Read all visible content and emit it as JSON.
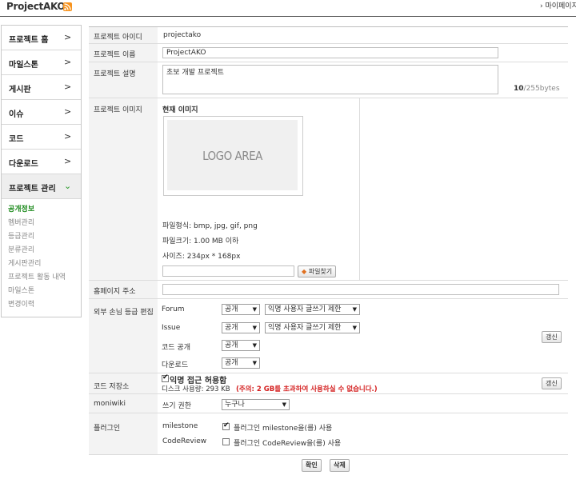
{
  "header": {
    "site_title": "ProjectAKO",
    "rss_icon": "rss-icon",
    "top_link": "› 마이페이지"
  },
  "sidebar": {
    "items": [
      {
        "label": "프로젝트 홈",
        "chevron": ">"
      },
      {
        "label": "마일스톤",
        "chevron": ">"
      },
      {
        "label": "게시판",
        "chevron": ">"
      },
      {
        "label": "이슈",
        "chevron": ">"
      },
      {
        "label": "코드",
        "chevron": ">"
      },
      {
        "label": "다운로드",
        "chevron": ">"
      },
      {
        "label": "프로젝트 관리",
        "chevron": "⌄"
      }
    ],
    "subitems": [
      {
        "label": "공개정보",
        "current": true
      },
      {
        "label": "멤버관리"
      },
      {
        "label": "등급관리"
      },
      {
        "label": "분류관리"
      },
      {
        "label": "게시판관리"
      },
      {
        "label": "프로젝트 활동 내역"
      },
      {
        "label": "마일스톤"
      },
      {
        "label": "변경이력"
      }
    ]
  },
  "form": {
    "project_id": {
      "label": "프로젝트 아이디",
      "value": "projectako"
    },
    "project_name": {
      "label": "프로젝트 이름",
      "value": "ProjectAKO"
    },
    "project_desc": {
      "label": "프로젝트 설명",
      "value": "초보 개발 프로젝트",
      "counter_current": "10",
      "counter_total": "/255bytes"
    },
    "project_image": {
      "label": "프로젝트 이미지",
      "current_title": "현재 이미지",
      "logo_text": "LOGO AREA",
      "format": "파일형식: bmp, jpg, gif, png",
      "size": "파일크기: 1.00 MB 이하",
      "dimensions": "사이즈: 234px * 168px",
      "file_button": "파일찾기"
    },
    "homepage": {
      "label": "홈페이지 주소",
      "value": ""
    },
    "guest_perm": {
      "label": "외부 손님 등급 편집",
      "rows": [
        {
          "name": "Forum",
          "access": "공개",
          "write": "익명 사용자 글쓰기 제한"
        },
        {
          "name": "Issue",
          "access": "공개",
          "write": "익명 사용자 글쓰기 제한"
        },
        {
          "name": "코드 공개",
          "access": "공개"
        },
        {
          "name": "다운로드",
          "access": "공개"
        }
      ],
      "update_button": "갱신"
    },
    "code_repo": {
      "label": "코드 저장소",
      "anon_access": "익명 접근 허용함",
      "disk_usage": "디스크 사용량: 293 KB",
      "warning": "(주의: 2 GB를 초과하여 사용하실 수 없습니다.)",
      "update_button": "갱신"
    },
    "moniwiki": {
      "label": "moniwiki",
      "write_perm_label": "쓰기 권한",
      "write_perm_value": "누구나"
    },
    "plugins": {
      "label": "플러그인",
      "items": [
        {
          "name": "milestone",
          "checkbox_label": "플러그인 milestone을(를) 사용",
          "checked": true
        },
        {
          "name": "CodeReview",
          "checkbox_label": "플러그인 CodeReview을(를) 사용",
          "checked": false
        }
      ]
    },
    "confirm_button": "확인",
    "delete_button": "삭제"
  }
}
